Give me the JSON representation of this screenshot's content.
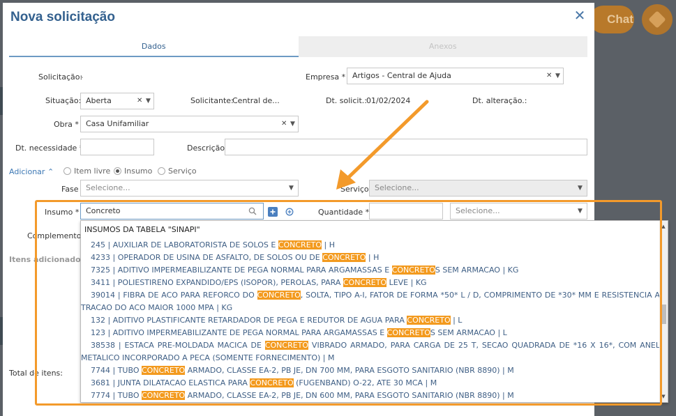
{
  "modal": {
    "title": "Nova solicitação",
    "close_icon": "close-icon"
  },
  "tabs": [
    {
      "label": "Dados",
      "active": true
    },
    {
      "label": "Anexos",
      "active": false
    }
  ],
  "background": {
    "chat_label": "Chat"
  },
  "form": {
    "solicitacao_label": "Solicitação:",
    "solicitacao_value": "-",
    "empresa_label": "Empresa *",
    "empresa_value": "Artigos - Central de Ajuda",
    "situacao_label": "Situação:",
    "situacao_value": "Aberta",
    "solicitante_label": "Solicitante:",
    "solicitante_value": "Central de...",
    "dt_solicit_label": "Dt. solicit.:",
    "dt_solicit_value": "01/02/2024",
    "dt_alteracao_label": "Dt. alteração.:",
    "obra_label": "Obra *",
    "obra_value": "Casa Unifamiliar",
    "dt_necessidade_label": "Dt. necessidade *",
    "descricao_label": "Descrição",
    "adicionar_label": "Adicionar",
    "radio_options": [
      {
        "label": "Item livre",
        "selected": false
      },
      {
        "label": "Insumo",
        "selected": true
      },
      {
        "label": "Serviço",
        "selected": false
      }
    ],
    "fase_label": "Fase",
    "fase_placeholder": "Selecione...",
    "servico_label": "Serviço",
    "servico_placeholder": "Selecione...",
    "insumo_label": "Insumo *",
    "insumo_value": "Concreto",
    "quantidade_label": "Quantidade *",
    "unidade_placeholder": "Selecione...",
    "complemento_label": "Complemento",
    "itens_adicionados_label": "Itens adicionados",
    "total_itens_label": "Total de itens:"
  },
  "dropdown": {
    "group_title": "INSUMOS DA TABELA \"SINAPI\"",
    "items": [
      {
        "pre": "245 | AUXILIAR DE LABORATORISTA DE SOLOS E ",
        "hl": "CONCRETO",
        "post": " | H",
        "wrap": false
      },
      {
        "pre": "4233 | OPERADOR DE USINA DE ASFALTO, DE SOLOS OU DE ",
        "hl": "CONCRETO",
        "post": " | H",
        "wrap": false
      },
      {
        "pre": "7325 | ADITIVO IMPERMEABILIZANTE DE PEGA NORMAL PARA ARGAMASSAS E ",
        "hl": "CONCRETO",
        "post": "S SEM ARMACAO | KG",
        "wrap": false
      },
      {
        "pre": "3411 | POLIESTIRENO EXPANDIDO/EPS (ISOPOR), PEROLAS, PARA ",
        "hl": "CONCRETO",
        "post": " LEVE | KG",
        "wrap": false
      },
      {
        "pre": "39014 | FIBRA DE ACO PARA REFORCO DO ",
        "hl": "CONCRETO",
        "post": ", SOLTA, TIPO A-I, FATOR DE FORMA *50* L / D, COMPRIMENTO DE *30* MM E RESISTENCIA A TRACAO DO ACO MAIOR 1000 MPA | KG",
        "wrap": true
      },
      {
        "pre": "132 | ADITIVO PLASTIFICANTE RETARDADOR DE PEGA E REDUTOR DE AGUA PARA ",
        "hl": "CONCRETO",
        "post": " | L",
        "wrap": false
      },
      {
        "pre": "123 | ADITIVO IMPERMEABILIZANTE DE PEGA NORMAL PARA ARGAMASSAS E ",
        "hl": "CONCRETO",
        "post": "S SEM ARMACAO | L",
        "wrap": false
      },
      {
        "pre": "38538 | ESTACA PRE-MOLDADA MACICA DE ",
        "hl": "CONCRETO",
        "post": " VIBRADO ARMADO, PARA CARGA DE 25 T, SECAO QUADRADA DE *16 X 16*, COM ANEL METALICO INCORPORADO A PECA (SOMENTE FORNECIMENTO) | M",
        "wrap": true
      },
      {
        "pre": "7744 | TUBO ",
        "hl": "CONCRETO",
        "post": " ARMADO, CLASSE EA-2, PB JE, DN 700 MM, PARA ESGOTO SANITARIO (NBR 8890) | M",
        "wrap": false
      },
      {
        "pre": "3681 | JUNTA DILATACAO ELASTICA PARA ",
        "hl": "CONCRETO",
        "post": " (FUGENBAND) O-22, ATE 30 MCA | M",
        "wrap": false
      },
      {
        "pre": "7774 | TUBO ",
        "hl": "CONCRETO",
        "post": " ARMADO, CLASSE EA-2, PB JE, DN 600 MM, PARA ESGOTO SANITARIO (NBR 8890) | M",
        "wrap": false
      }
    ]
  },
  "colors": {
    "title_blue": "#34618f",
    "highlight_orange": "#f39a1e",
    "annotation_orange": "#f39a2b"
  }
}
